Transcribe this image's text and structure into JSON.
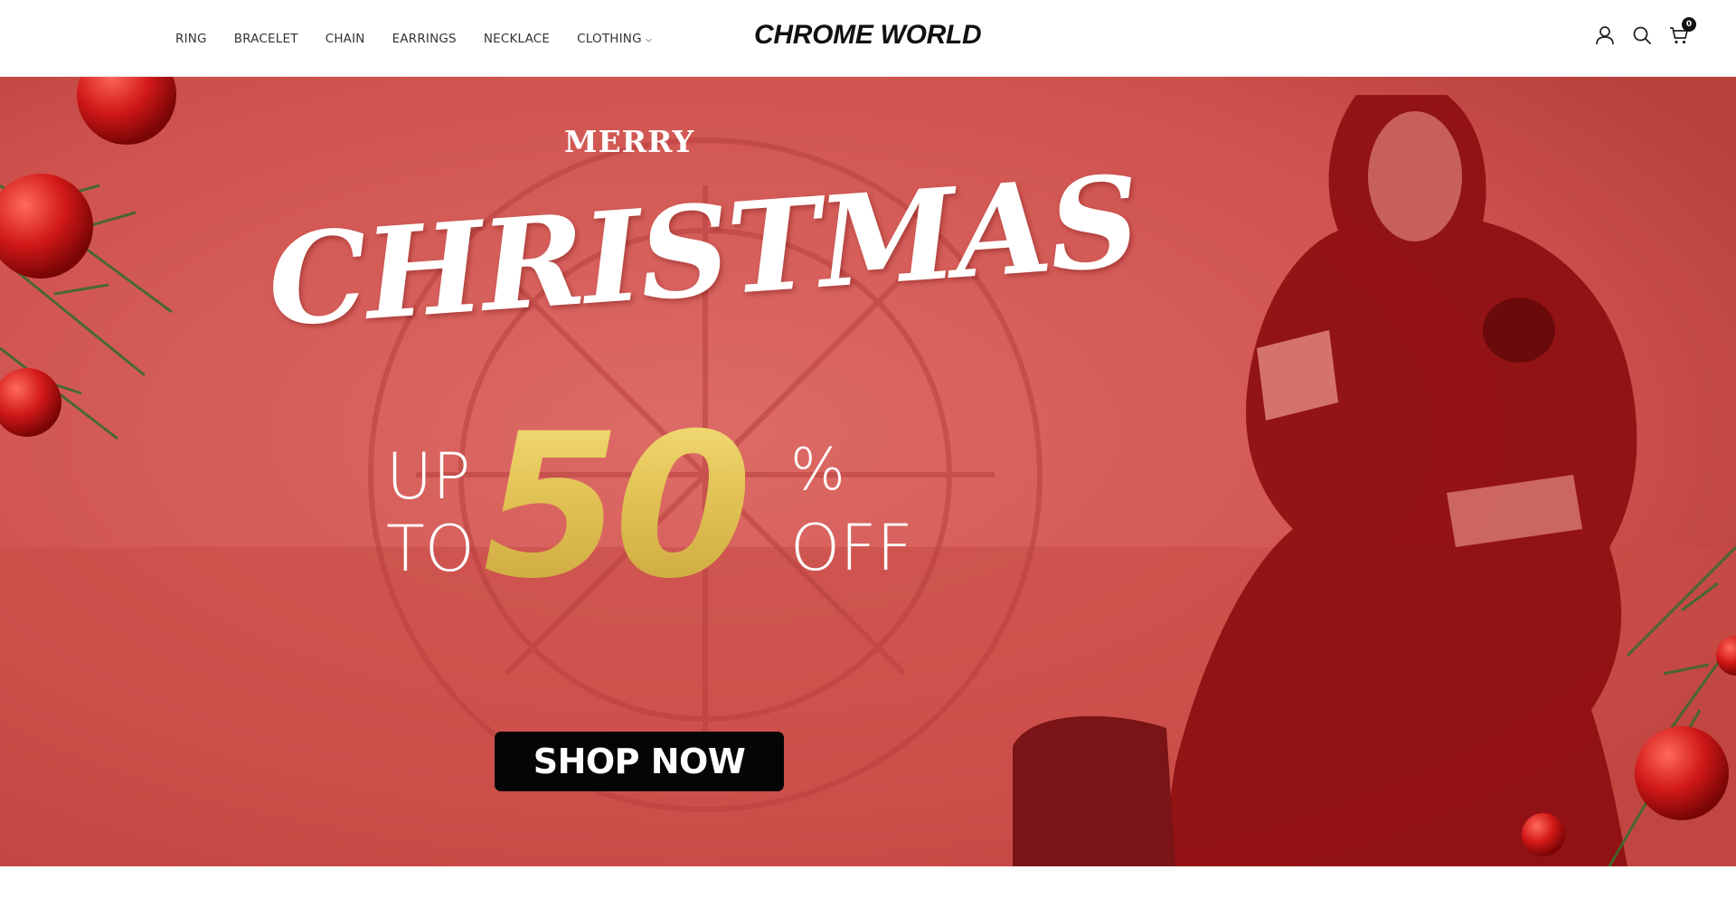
{
  "header": {
    "logo": "CHROME WORLD",
    "nav": [
      {
        "label": "RING"
      },
      {
        "label": "BRACELET"
      },
      {
        "label": "CHAIN"
      },
      {
        "label": "EARRINGS"
      },
      {
        "label": "NECKLACE"
      },
      {
        "label": "CLOTHING",
        "has_dropdown": true
      }
    ],
    "icons": [
      "account-icon",
      "search-icon",
      "cart-icon"
    ],
    "cart_count": "0"
  },
  "hero": {
    "eyebrow": "MERRY",
    "headline": "CHRISTMAS",
    "discount_prefix_line1": "UP",
    "discount_prefix_line2": "TO",
    "discount_value": "50",
    "discount_percent": "%",
    "discount_suffix": "OFF",
    "cta_label": "SHOP NOW",
    "colors": {
      "overlay": "#d45a56",
      "gold": "#e2c255",
      "button": "#050505"
    }
  }
}
